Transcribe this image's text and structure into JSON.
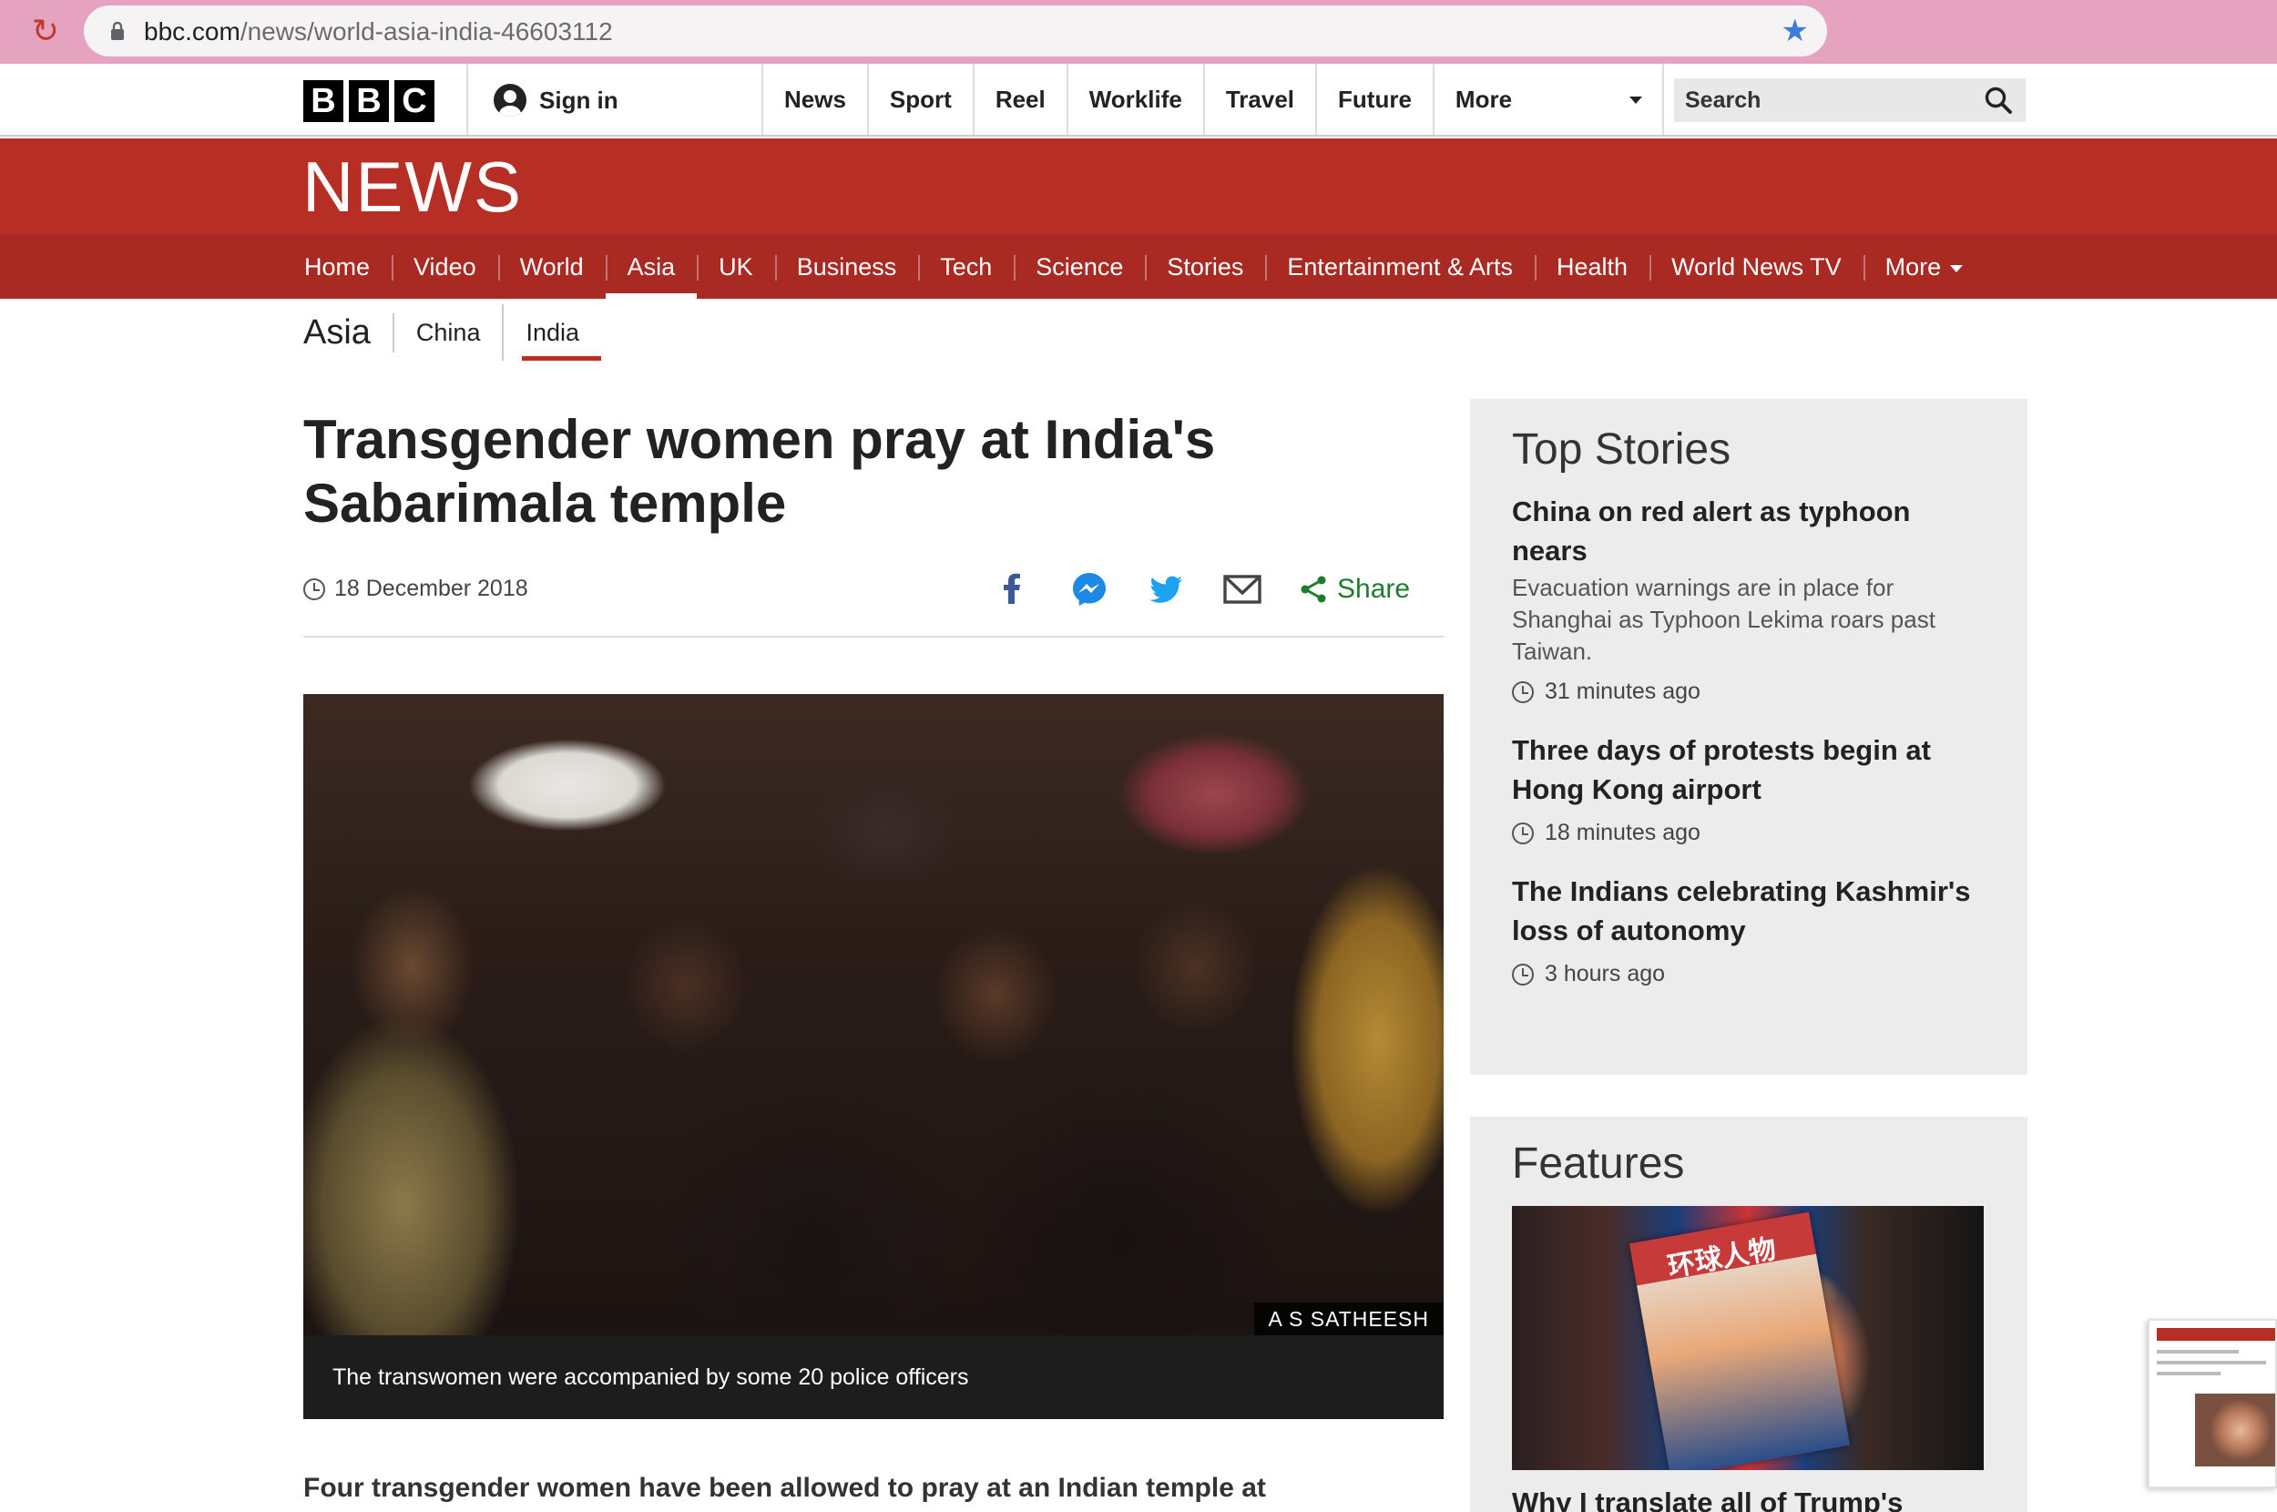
{
  "browser": {
    "url_domain": "bbc.com",
    "url_path": "/news/world-asia-india-46603112"
  },
  "global_nav": {
    "logo_letters": [
      "B",
      "B",
      "C"
    ],
    "sign_in": "Sign in",
    "items": [
      "News",
      "Sport",
      "Reel",
      "Worklife",
      "Travel",
      "Future"
    ],
    "more": "More",
    "search_placeholder": "Search"
  },
  "banner": {
    "title": "NEWS"
  },
  "news_nav": {
    "items": [
      "Home",
      "Video",
      "World",
      "Asia",
      "UK",
      "Business",
      "Tech",
      "Science",
      "Stories",
      "Entertainment & Arts",
      "Health",
      "World News TV"
    ],
    "active": "Asia",
    "more": "More"
  },
  "sub_nav": {
    "title": "Asia",
    "items": [
      "China",
      "India"
    ],
    "active": "India"
  },
  "article": {
    "headline": "Transgender women pray at India's Sabarimala temple",
    "date": "18 December 2018",
    "share_label": "Share",
    "image_credit": "A S SATHEESH",
    "caption": "The transwomen were accompanied by some 20 police officers",
    "lede": "Four transgender women have been allowed to pray at an Indian temple at"
  },
  "top_stories": {
    "title": "Top Stories",
    "stories": [
      {
        "headline": "China on red alert as typhoon nears",
        "summary": "Evacuation warnings are in place for Shanghai as Typhoon Lekima roars past Taiwan.",
        "time": "31 minutes ago"
      },
      {
        "headline": "Three days of protests begin at Hong Kong airport",
        "summary": "",
        "time": "18 minutes ago"
      },
      {
        "headline": "The Indians celebrating Kashmir's loss of autonomy",
        "summary": "",
        "time": "3 hours ago"
      }
    ]
  },
  "features": {
    "title": "Features",
    "image_text": "环球人物",
    "headline": "Why I translate all of Trump's"
  },
  "colors": {
    "bbc_red": "#b72e24",
    "nav_red": "#a82a22",
    "share_green": "#1e7d2d",
    "facebook": "#3b5998",
    "messenger": "#1e88e5",
    "twitter": "#1da1f2"
  }
}
